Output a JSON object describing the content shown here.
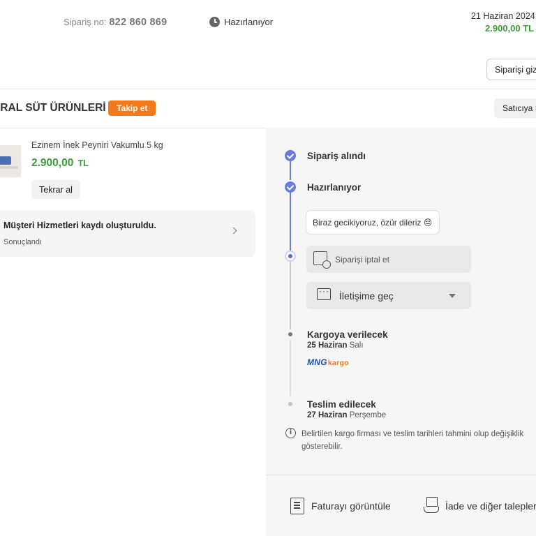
{
  "header": {
    "order_no_label": "Sipariş no:",
    "order_no": "822 860 869",
    "status": "Hazırlanıyor",
    "date": "21 Haziran 2024",
    "total": "2.900,00 TL",
    "hide_order_label": "Siparişi gizle"
  },
  "seller": {
    "name": "IRAL SÜT ÜRÜNLERİ",
    "follow_label": "Takip et",
    "contact_seller_label": "Satıcıya Sor"
  },
  "product": {
    "name": "Ezinem İnek Peyniri Vakumlu 5 kg",
    "price": "2.900,00",
    "currency": "TL",
    "reorder_label": "Tekrar al"
  },
  "customer_service": {
    "title": "Müşteri Hizmetleri kaydı oluşturuldu.",
    "status": "Sonuçlandı"
  },
  "timeline": {
    "received": "Sipariş alındı",
    "preparing": "Hazırlanıyor",
    "delay_message": "Biraz gecikiyoruz, özür dileriz 😔",
    "cancel_label": "Siparişi iptal et",
    "contact_label": "İletişime geç",
    "shipping": {
      "label": "Kargoya verilecek",
      "date": "25 Haziran",
      "day": "Salı"
    },
    "carrier": {
      "main": "MNG",
      "sub": "kargo"
    },
    "delivery": {
      "label": "Teslim edilecek",
      "date": "27 Haziran",
      "day": "Perşembe"
    },
    "note": "Belirtilen kargo firması ve teslim tarihleri tahmini olup değişiklik gösterebilir."
  },
  "actions": {
    "invoice_label": "Faturayı görüntüle",
    "returns_label": "İade ve diğer talepler"
  },
  "colors": {
    "accent_orange": "#f27a1a",
    "price_green": "#3a9c3a",
    "timeline_blue": "#6a7be0",
    "carrier_blue": "#1f4fb5"
  },
  "icons": {
    "status": "clock-icon",
    "cs_arrow": "chevron-right-icon",
    "cancel": "package-cancel-icon",
    "contact": "chat-icon",
    "contact_caret": "caret-down-icon",
    "info": "info-icon",
    "invoice": "document-icon",
    "returns": "return-box-icon"
  }
}
